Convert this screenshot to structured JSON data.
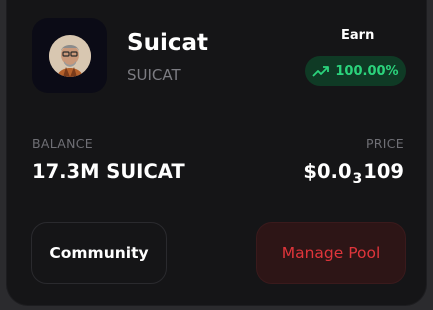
{
  "token": {
    "name": "Suicat",
    "symbol": "SUICAT",
    "avatar_icon": "cat-avatar-icon"
  },
  "earn": {
    "label": "Earn",
    "apy": "100.00%",
    "trend_icon": "trending-up-icon",
    "color": "#2bd37c"
  },
  "stats": {
    "balance_label": "BALANCE",
    "balance_value": "17.3M SUICAT",
    "price_label": "PRICE",
    "price_prefix": "$0.0",
    "price_zeros": "3",
    "price_digits": "109"
  },
  "actions": {
    "community_label": "Community",
    "manage_label": "Manage Pool",
    "manage_color": "#e0353b"
  }
}
